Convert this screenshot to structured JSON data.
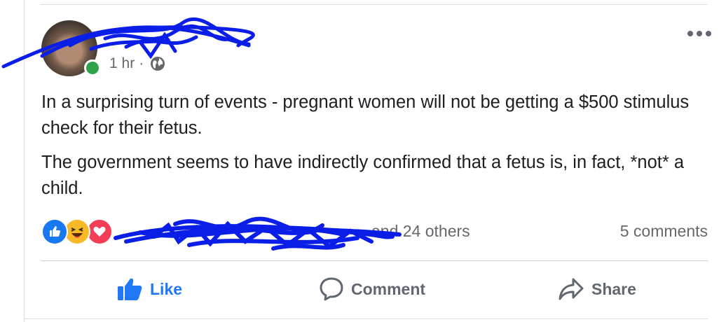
{
  "post": {
    "timestamp": "1 hr",
    "separator": "·",
    "privacy_icon": "globe-icon",
    "more_icon": "more-horizontal-icon",
    "paragraphs": [
      "In a surprising turn of events - pregnant women will not be getting a $500 stimulus check for their fetus.",
      "The government seems to have indirectly confirmed that a fetus is, in fact, *not* a child."
    ]
  },
  "reactions": {
    "icons": [
      "like-reaction-icon",
      "haha-reaction-icon",
      "love-reaction-icon"
    ],
    "summary": "and 24 others",
    "comments": "5 comments"
  },
  "actions": {
    "like": "Like",
    "comment": "Comment",
    "share": "Share"
  },
  "colors": {
    "accent": "#2078f4",
    "secondary_text": "#65676b",
    "online": "#31a24c",
    "redaction": "#0a1ee8"
  }
}
